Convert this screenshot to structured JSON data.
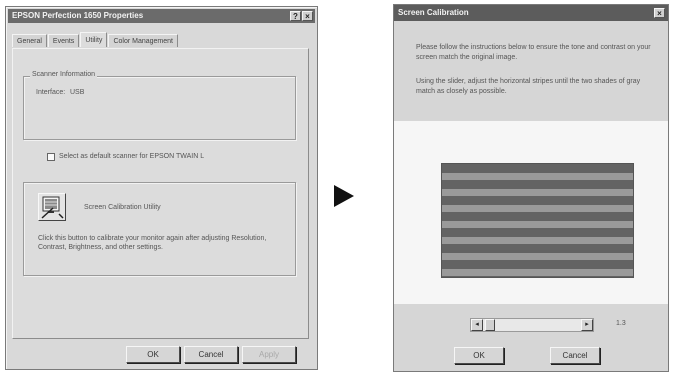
{
  "properties_dialog": {
    "title": "EPSON Perfection 1650 Properties",
    "title_buttons": [
      "?",
      "×"
    ],
    "tabs": [
      "General",
      "Events",
      "Utility",
      "Color Management"
    ],
    "scanner_info": {
      "group_label": "Scanner Information",
      "interface_label": "Interface:",
      "interface_value": "USB"
    },
    "default_scanner_checkbox": {
      "checked": false,
      "label": "Select as default scanner for EPSON TWAIN L"
    },
    "calibration": {
      "utility_label": "Screen Calibration Utility",
      "description": "Click this button to calibrate your monitor again after adjusting Resolution, Contrast, Brightness, and other settings."
    },
    "buttons": {
      "ok": "OK",
      "cancel": "Cancel",
      "apply": "Apply"
    }
  },
  "calibration_dialog": {
    "title": "Screen Calibration",
    "close": "×",
    "instructions_1": "Please follow the instructions below to ensure the tone and contrast on your screen match the original image.",
    "instructions_2": "Using the slider, adjust the horizontal stripes until the two shades of gray match as closely as possible.",
    "slider": {
      "left_arrow": "◂",
      "right_arrow": "▸",
      "value": "1.3"
    },
    "buttons": {
      "ok": "OK",
      "cancel": "Cancel"
    }
  }
}
